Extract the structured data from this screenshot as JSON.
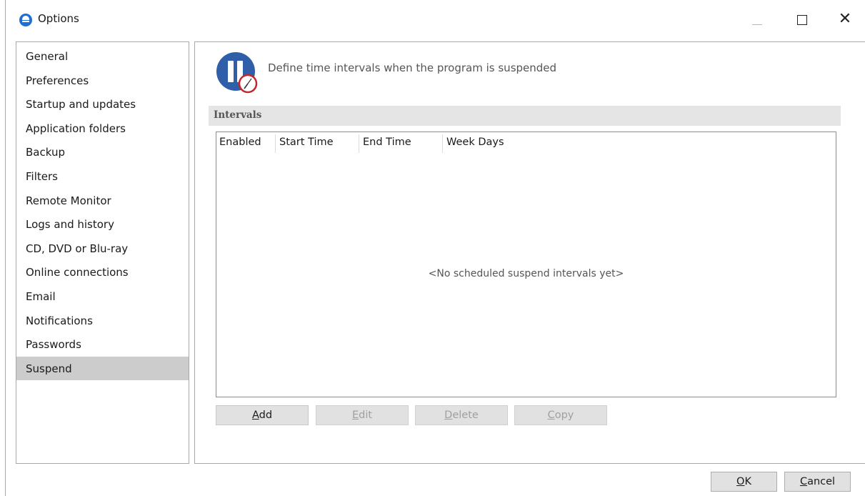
{
  "window": {
    "title": "Options",
    "icon": "app-logo-icon",
    "controls": {
      "minimize": "—",
      "maximize": "□",
      "close": "✕"
    }
  },
  "nav": {
    "items": [
      {
        "label": "General"
      },
      {
        "label": "Preferences"
      },
      {
        "label": "Startup and updates"
      },
      {
        "label": "Application folders"
      },
      {
        "label": "Backup"
      },
      {
        "label": "Filters"
      },
      {
        "label": "Remote Monitor"
      },
      {
        "label": "Logs and history"
      },
      {
        "label": "CD, DVD or Blu-ray"
      },
      {
        "label": "Online connections"
      },
      {
        "label": "Email"
      },
      {
        "label": "Notifications"
      },
      {
        "label": "Passwords"
      },
      {
        "label": "Suspend"
      }
    ],
    "selected": "Suspend"
  },
  "panel": {
    "header_icon": "pause-clock-icon",
    "description": "Define time intervals when the program is suspended",
    "section_title": "Intervals",
    "table": {
      "columns": [
        "Enabled",
        "Start Time",
        "End Time",
        "Week Days"
      ],
      "rows": [],
      "empty_message": "<No scheduled suspend intervals yet>"
    },
    "buttons": {
      "add": {
        "label": "Add",
        "mnemonic": "A",
        "rest": "dd",
        "enabled": true
      },
      "edit": {
        "label": "Edit",
        "mnemonic": "E",
        "rest": "dit",
        "enabled": false
      },
      "delete": {
        "label": "Delete",
        "mnemonic": "D",
        "rest": "elete",
        "enabled": false
      },
      "copy": {
        "label": "Copy",
        "mnemonic": "C",
        "rest": "opy",
        "enabled": false
      }
    }
  },
  "dialog_buttons": {
    "ok": {
      "label": "OK",
      "mnemonic": "O",
      "rest": "K"
    },
    "cancel": {
      "label": "Cancel",
      "mnemonic": "C",
      "rest": "ancel"
    }
  },
  "colors": {
    "accent": "#1e6fd4",
    "icon_blue": "#2e5fa8",
    "icon_red": "#c0282e",
    "selected_bg": "#cccccc",
    "section_bg": "#e5e5e5",
    "button_bg": "#e1e1e1"
  }
}
